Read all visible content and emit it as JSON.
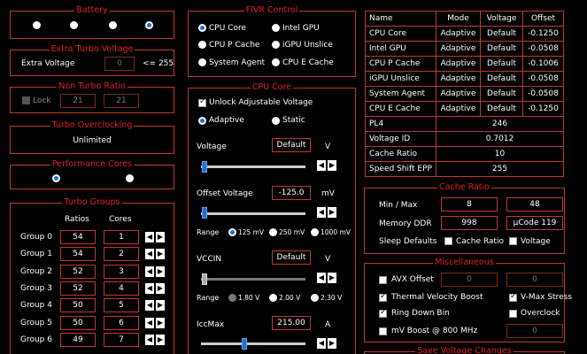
{
  "battery": {
    "title": "Battery"
  },
  "extra_turbo_voltage": {
    "title": "Extra Turbo Voltage",
    "label": "Extra Voltage",
    "value": "0",
    "limit": "<= 255"
  },
  "non_turbo_ratio": {
    "title": "Non Turbo Ratio",
    "lock_label": "Lock",
    "value1": "21",
    "value2": "21"
  },
  "turbo_overclocking": {
    "title": "Turbo Overclocking",
    "value": "Unlimited"
  },
  "performance_cores": {
    "title": "Performance Cores"
  },
  "turbo_groups": {
    "title": "Turbo Groups",
    "col_ratios": "Ratios",
    "col_cores": "Cores",
    "groups": [
      {
        "name": "Group 0",
        "ratio": "54",
        "cores": "1"
      },
      {
        "name": "Group 1",
        "ratio": "54",
        "cores": "2"
      },
      {
        "name": "Group 2",
        "ratio": "52",
        "cores": "3"
      },
      {
        "name": "Group 3",
        "ratio": "52",
        "cores": "4"
      },
      {
        "name": "Group 4",
        "ratio": "50",
        "cores": "5"
      },
      {
        "name": "Group 5",
        "ratio": "50",
        "cores": "6"
      },
      {
        "name": "Group 6",
        "ratio": "49",
        "cores": "7"
      }
    ]
  },
  "fivr_control": {
    "title": "FIVR Control",
    "options": [
      "CPU Core",
      "Intel GPU",
      "CPU P Cache",
      "iGPU Unslice",
      "System Agent",
      "CPU E Cache"
    ]
  },
  "cpu_core": {
    "title": "CPU Core",
    "unlock_label": "Unlock Adjustable Voltage",
    "adaptive_label": "Adaptive",
    "static_label": "Static",
    "voltage_label": "Voltage",
    "voltage_value": "Default",
    "voltage_unit": "V",
    "offset_label": "Offset Voltage",
    "offset_value": "-125.0",
    "offset_unit": "mV",
    "range_label": "Range",
    "offset_ranges": [
      "125 mV",
      "250 mV",
      "1000 mV"
    ],
    "vccin_label": "VCCIN",
    "vccin_value": "Default",
    "vccin_unit": "V",
    "vccin_ranges": [
      "1.80 V",
      "2.00 V",
      "2.30 V"
    ],
    "iccmax_label": "IccMax",
    "iccmax_value": "215.00",
    "iccmax_unit": "A"
  },
  "fivr_table": {
    "headers": [
      "Name",
      "Mode",
      "Voltage",
      "Offset"
    ],
    "rows": [
      [
        "CPU Core",
        "Adaptive",
        "Default",
        "-0.1250"
      ],
      [
        "Intel GPU",
        "Adaptive",
        "Default",
        "-0.0508"
      ],
      [
        "CPU P Cache",
        "Adaptive",
        "Default",
        "-0.1006"
      ],
      [
        "iGPU Unslice",
        "Adaptive",
        "Default",
        "-0.0508"
      ],
      [
        "System Agent",
        "Adaptive",
        "Default",
        "-0.0508"
      ],
      [
        "CPU E Cache",
        "Adaptive",
        "Default",
        "-0.1250"
      ]
    ],
    "extra_rows": [
      [
        "PL4",
        "246"
      ],
      [
        "Voltage ID",
        "0.7012"
      ],
      [
        "Cache Ratio",
        "10"
      ],
      [
        "Speed Shift EPP",
        "255"
      ]
    ]
  },
  "cache_ratio": {
    "title": "Cache Ratio",
    "minmax_label": "Min / Max",
    "min_value": "8",
    "max_value": "48",
    "memory_label": "Memory DDR",
    "memory_value": "998",
    "ucode_value": "µCode 119",
    "sleep_label": "Sleep Defaults",
    "cache_ratio_cb": "Cache Ratio",
    "voltage_cb": "Voltage"
  },
  "miscellaneous": {
    "title": "Miscellaneous",
    "avx_label": "AVX Offset",
    "avx_value": "0",
    "avx_value2": "0",
    "tvb_label": "Thermal Velocity Boost",
    "vmax_label": "V-Max Stress",
    "ring_label": "Ring Down Bin",
    "overclock_label": "Overclock",
    "mvboost_label": "mV Boost @ 800 MHz",
    "mvboost_value": "0"
  },
  "bottom_group": {
    "title": "Save Voltage Changes"
  }
}
